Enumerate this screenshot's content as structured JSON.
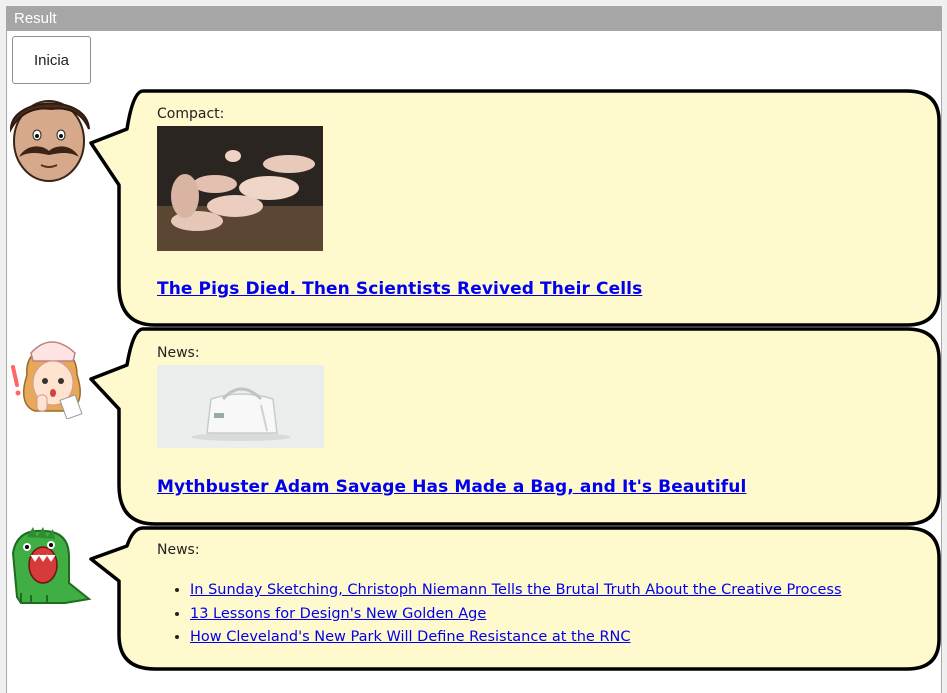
{
  "window": {
    "title": "Result"
  },
  "start_button": {
    "label": "Inicia"
  },
  "posts": [
    {
      "avatar": "mustache-man-icon",
      "label": "Compact:",
      "headline": "The Pigs Died. Then Scientists Revived Their Cells"
    },
    {
      "avatar": "nurse-girl-icon",
      "label": "News:",
      "headline": "Mythbuster Adam Savage Has Made a Bag, and It's Beautiful"
    },
    {
      "avatar": "green-monster-icon",
      "label": "News:",
      "links": [
        "In Sunday Sketching, Christoph Niemann Tells the Brutal Truth About the Creative Process",
        "13 Lessons for Design's New Golden Age",
        "How Cleveland's New Park Will Define Resistance at the RNC"
      ]
    }
  ],
  "colors": {
    "bubble_fill": "#fffacd",
    "bubble_stroke": "#000000",
    "link": "#0000ee"
  }
}
